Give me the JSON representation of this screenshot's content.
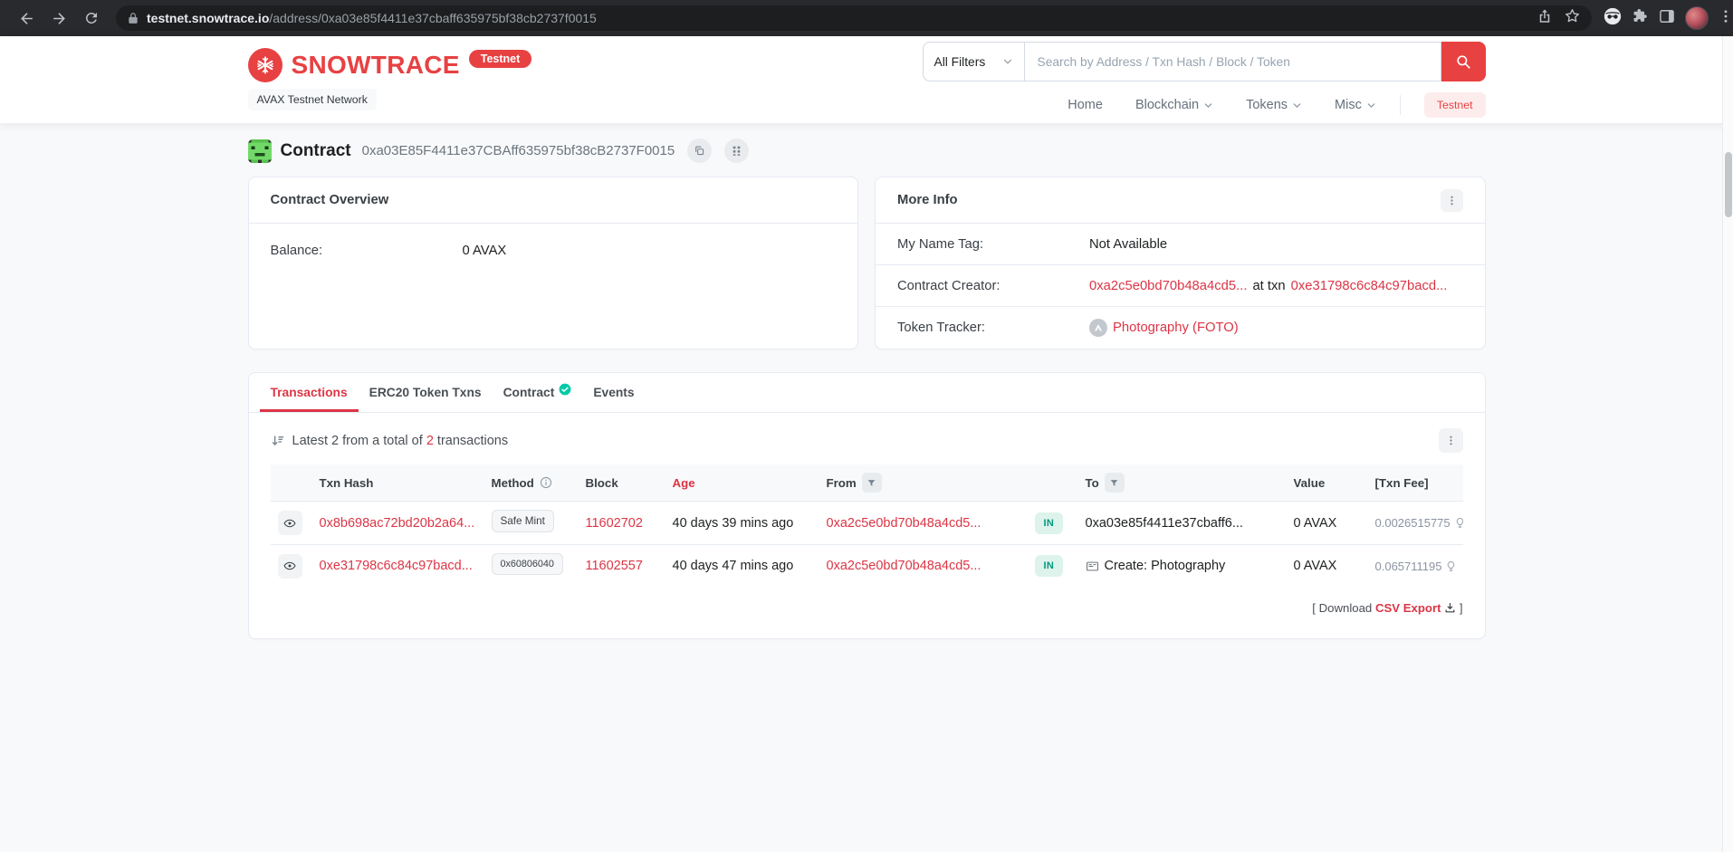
{
  "browser": {
    "url_domain": "testnet.snowtrace.io",
    "url_path": "/address/0xa03e85f4411e37cbaff635975bf38cb2737f0015"
  },
  "header": {
    "brand": "SNOWTRACE",
    "brand_badge": "Testnet",
    "network_label": "AVAX Testnet Network",
    "search": {
      "filter_label": "All Filters",
      "placeholder": "Search by Address / Txn Hash / Block / Token"
    },
    "nav": {
      "home": "Home",
      "blockchain": "Blockchain",
      "tokens": "Tokens",
      "misc": "Misc",
      "testnet": "Testnet"
    }
  },
  "page": {
    "type_label": "Contract",
    "address": "0xa03E85F4411e37CBAff635975bf38cB2737F0015"
  },
  "overview": {
    "title": "Contract Overview",
    "balance_label": "Balance:",
    "balance_value": "0 AVAX"
  },
  "more_info": {
    "title": "More Info",
    "name_tag_label": "My Name Tag:",
    "name_tag_value": "Not Available",
    "creator_label": "Contract Creator:",
    "creator_address": "0xa2c5e0bd70b48a4cd5...",
    "creator_connector": "at txn",
    "creator_txn": "0xe31798c6c84c97bacd...",
    "tracker_label": "Token Tracker:",
    "tracker_value": "Photography (FOTO)"
  },
  "tabs": {
    "transactions": "Transactions",
    "erc20": "ERC20 Token Txns",
    "contract": "Contract",
    "events": "Events"
  },
  "transactions": {
    "summary_prefix": "Latest 2 from a total of",
    "summary_total": "2",
    "summary_suffix": "transactions",
    "columns": {
      "hash": "Txn Hash",
      "method": "Method",
      "block": "Block",
      "age": "Age",
      "from": "From",
      "to": "To",
      "value": "Value",
      "fee": "[Txn Fee]"
    },
    "rows": [
      {
        "hash": "0x8b698ac72bd20b2a64...",
        "method": "Safe Mint",
        "block": "11602702",
        "age": "40 days 39 mins ago",
        "from": "0xa2c5e0bd70b48a4cd5...",
        "direction": "IN",
        "to": "0xa03e85f4411e37cbaff6...",
        "value": "0 AVAX",
        "fee": "0.0026515775"
      },
      {
        "hash": "0xe31798c6c84c97bacd...",
        "method": "0x60806040",
        "block": "11602557",
        "age": "40 days 47 mins ago",
        "from": "0xa2c5e0bd70b48a4cd5...",
        "direction": "IN",
        "to": "Create: Photography",
        "value": "0 AVAX",
        "fee": "0.065711195"
      }
    ],
    "download_open": "[ Download",
    "download_link": "CSV Export",
    "download_close": "]"
  },
  "colors": {
    "brand_red": "#e84142",
    "link_red": "#dc3545",
    "in_badge_bg": "#ddf3ec",
    "in_badge_text": "#02977e",
    "page_bg": "#f8f9fa",
    "card_border": "#e7eaf3"
  }
}
